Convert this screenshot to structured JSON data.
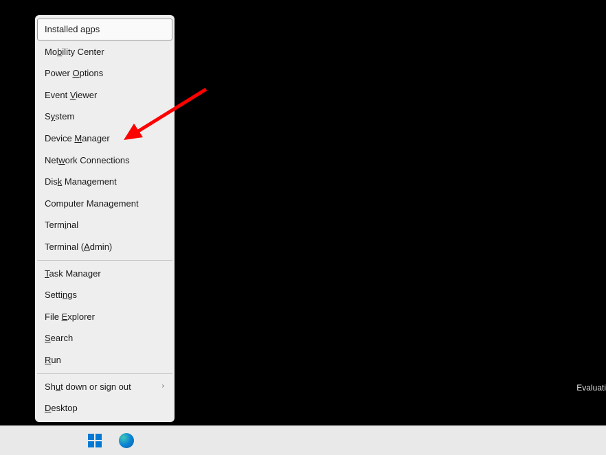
{
  "menu": {
    "sections": [
      [
        {
          "id": "installed-apps",
          "pre": "Installed a",
          "u": "p",
          "post": "ps",
          "selected": true
        },
        {
          "id": "mobility-center",
          "pre": "Mo",
          "u": "b",
          "post": "ility Center"
        },
        {
          "id": "power-options",
          "pre": "Power ",
          "u": "O",
          "post": "ptions"
        },
        {
          "id": "event-viewer",
          "pre": "Event ",
          "u": "V",
          "post": "iewer"
        },
        {
          "id": "system",
          "pre": "S",
          "u": "y",
          "post": "stem"
        },
        {
          "id": "device-manager",
          "pre": "Device ",
          "u": "M",
          "post": "anager"
        },
        {
          "id": "network-connections",
          "pre": "Net",
          "u": "w",
          "post": "ork Connections"
        },
        {
          "id": "disk-management",
          "pre": "Dis",
          "u": "k",
          "post": " Management"
        },
        {
          "id": "computer-management",
          "pre": "Computer Mana",
          "u": "g",
          "post": "ement"
        },
        {
          "id": "terminal",
          "pre": "Term",
          "u": "i",
          "post": "nal"
        },
        {
          "id": "terminal-admin",
          "pre": "Terminal (",
          "u": "A",
          "post": "dmin)"
        }
      ],
      [
        {
          "id": "task-manager",
          "pre": "",
          "u": "T",
          "post": "ask Manager"
        },
        {
          "id": "settings",
          "pre": "Setti",
          "u": "n",
          "post": "gs"
        },
        {
          "id": "file-explorer",
          "pre": "File ",
          "u": "E",
          "post": "xplorer"
        },
        {
          "id": "search",
          "pre": "",
          "u": "S",
          "post": "earch"
        },
        {
          "id": "run",
          "pre": "",
          "u": "R",
          "post": "un"
        }
      ],
      [
        {
          "id": "shutdown",
          "pre": "Sh",
          "u": "u",
          "post": "t down or sign out",
          "submenu": true
        },
        {
          "id": "desktop",
          "pre": "",
          "u": "D",
          "post": "esktop"
        }
      ]
    ]
  },
  "watermark": "Evaluati",
  "annotation": {
    "target": "device-manager"
  }
}
